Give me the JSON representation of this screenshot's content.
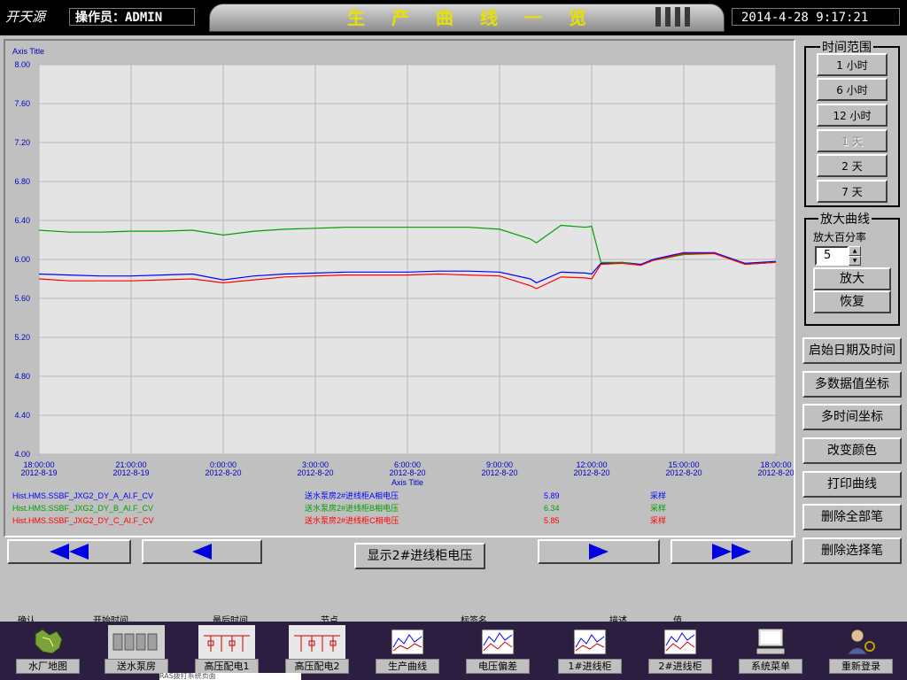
{
  "header": {
    "logo": "开天源",
    "operator_label": "操作员：",
    "operator_name": "ADMIN",
    "title": "生产曲线一览",
    "datetime": "2014-4-28   9:17:21"
  },
  "chart_data": {
    "type": "line",
    "ylabel": "Axis Title",
    "xlabel": "Axis Title",
    "ylim": [
      4.0,
      8.0
    ],
    "yticks": [
      "8.00",
      "7.60",
      "7.20",
      "6.80",
      "6.40",
      "6.00",
      "5.60",
      "5.20",
      "4.80",
      "4.40",
      "4.00"
    ],
    "xticks": [
      {
        "time": "18:00:00",
        "date": "2012-8-19"
      },
      {
        "time": "21:00:00",
        "date": "2012-8-19"
      },
      {
        "time": "0:00:00",
        "date": "2012-8-20"
      },
      {
        "time": "3:00:00",
        "date": "2012-8-20"
      },
      {
        "time": "6:00:00",
        "date": "2012-8-20"
      },
      {
        "time": "9:00:00",
        "date": "2012-8-20"
      },
      {
        "time": "12:00:00",
        "date": "2012-8-20"
      },
      {
        "time": "15:00:00",
        "date": "2012-8-20"
      },
      {
        "time": "18:00:00",
        "date": "2012-8-20"
      }
    ],
    "x_hours": [
      0,
      1,
      2,
      3,
      4,
      5,
      6,
      7,
      8,
      9,
      10,
      11,
      12,
      13,
      14,
      15,
      16,
      16.2,
      17,
      17.8,
      18,
      18.3,
      19,
      19.6,
      20,
      21,
      22,
      23,
      24
    ],
    "grid": true,
    "series": [
      {
        "tag": "Hist.HMS.SSBF_JXG2_DY_A_AI.F_CV",
        "name": "送水泵房2#进线柜A相电压",
        "value": "5.89",
        "mode": "采样",
        "color": "#0000ff",
        "values": [
          5.85,
          5.84,
          5.83,
          5.83,
          5.84,
          5.85,
          5.79,
          5.83,
          5.85,
          5.86,
          5.87,
          5.87,
          5.87,
          5.88,
          5.88,
          5.87,
          5.8,
          5.76,
          5.87,
          5.86,
          5.85,
          5.96,
          5.97,
          5.95,
          6.0,
          6.07,
          6.07,
          5.96,
          5.98
        ]
      },
      {
        "tag": "Hist.HMS.SSBF_JXG2_DY_B_AI.F_CV",
        "name": "送水泵房2#进线柜B相电压",
        "value": "6.34",
        "mode": "采样",
        "color": "#00a000",
        "values": [
          6.3,
          6.28,
          6.28,
          6.29,
          6.29,
          6.3,
          6.25,
          6.29,
          6.31,
          6.32,
          6.33,
          6.33,
          6.33,
          6.33,
          6.33,
          6.31,
          6.21,
          6.17,
          6.35,
          6.33,
          6.34,
          5.97,
          5.97,
          5.94,
          5.99,
          6.05,
          6.06,
          5.95,
          5.97
        ]
      },
      {
        "tag": "Hist.HMS.SSBF_JXG2_DY_C_AI.F_CV",
        "name": "送水泵房2#进线柜C相电压",
        "value": "5.85",
        "mode": "采样",
        "color": "#ff0000",
        "values": [
          5.8,
          5.78,
          5.78,
          5.78,
          5.79,
          5.8,
          5.76,
          5.79,
          5.82,
          5.83,
          5.84,
          5.84,
          5.84,
          5.85,
          5.84,
          5.83,
          5.73,
          5.7,
          5.82,
          5.81,
          5.8,
          5.95,
          5.96,
          5.94,
          5.99,
          6.06,
          6.06,
          5.95,
          5.97
        ]
      }
    ]
  },
  "nav": {
    "show_label": "显示2#进线柜电压"
  },
  "time_range": {
    "title": "时间范围",
    "options": [
      "1 小时",
      "6 小时",
      "12 小时",
      "1 天",
      "2 天",
      "7 天"
    ]
  },
  "zoom": {
    "title": "放大曲线",
    "percent_label": "放大百分率",
    "percent_value": "5",
    "zoom_label": "放大",
    "restore_label": "恢复"
  },
  "side_buttons": [
    "启始日期及时间",
    "多数据值坐标",
    "多时间坐标",
    "改变颜色",
    "打印曲线",
    "删除全部笔",
    "删除选择笔"
  ],
  "bottom_strip_text": [
    "确认",
    "开始时间",
    "最后时间",
    "节点",
    "标签名",
    "描述",
    "值"
  ],
  "bottom_nav": [
    "水厂地图",
    "送水泵房",
    "高压配电1",
    "高压配电2",
    "生产曲线",
    "电压偏差",
    "1#进线柜",
    "2#进线柜",
    "系统菜单",
    "重新登录"
  ],
  "status_text": "RAS拨打系统页面",
  "colors": {
    "title_text": "#e8e000",
    "bottom_bar": "#2c1e40",
    "arrow": "#0000e0"
  }
}
